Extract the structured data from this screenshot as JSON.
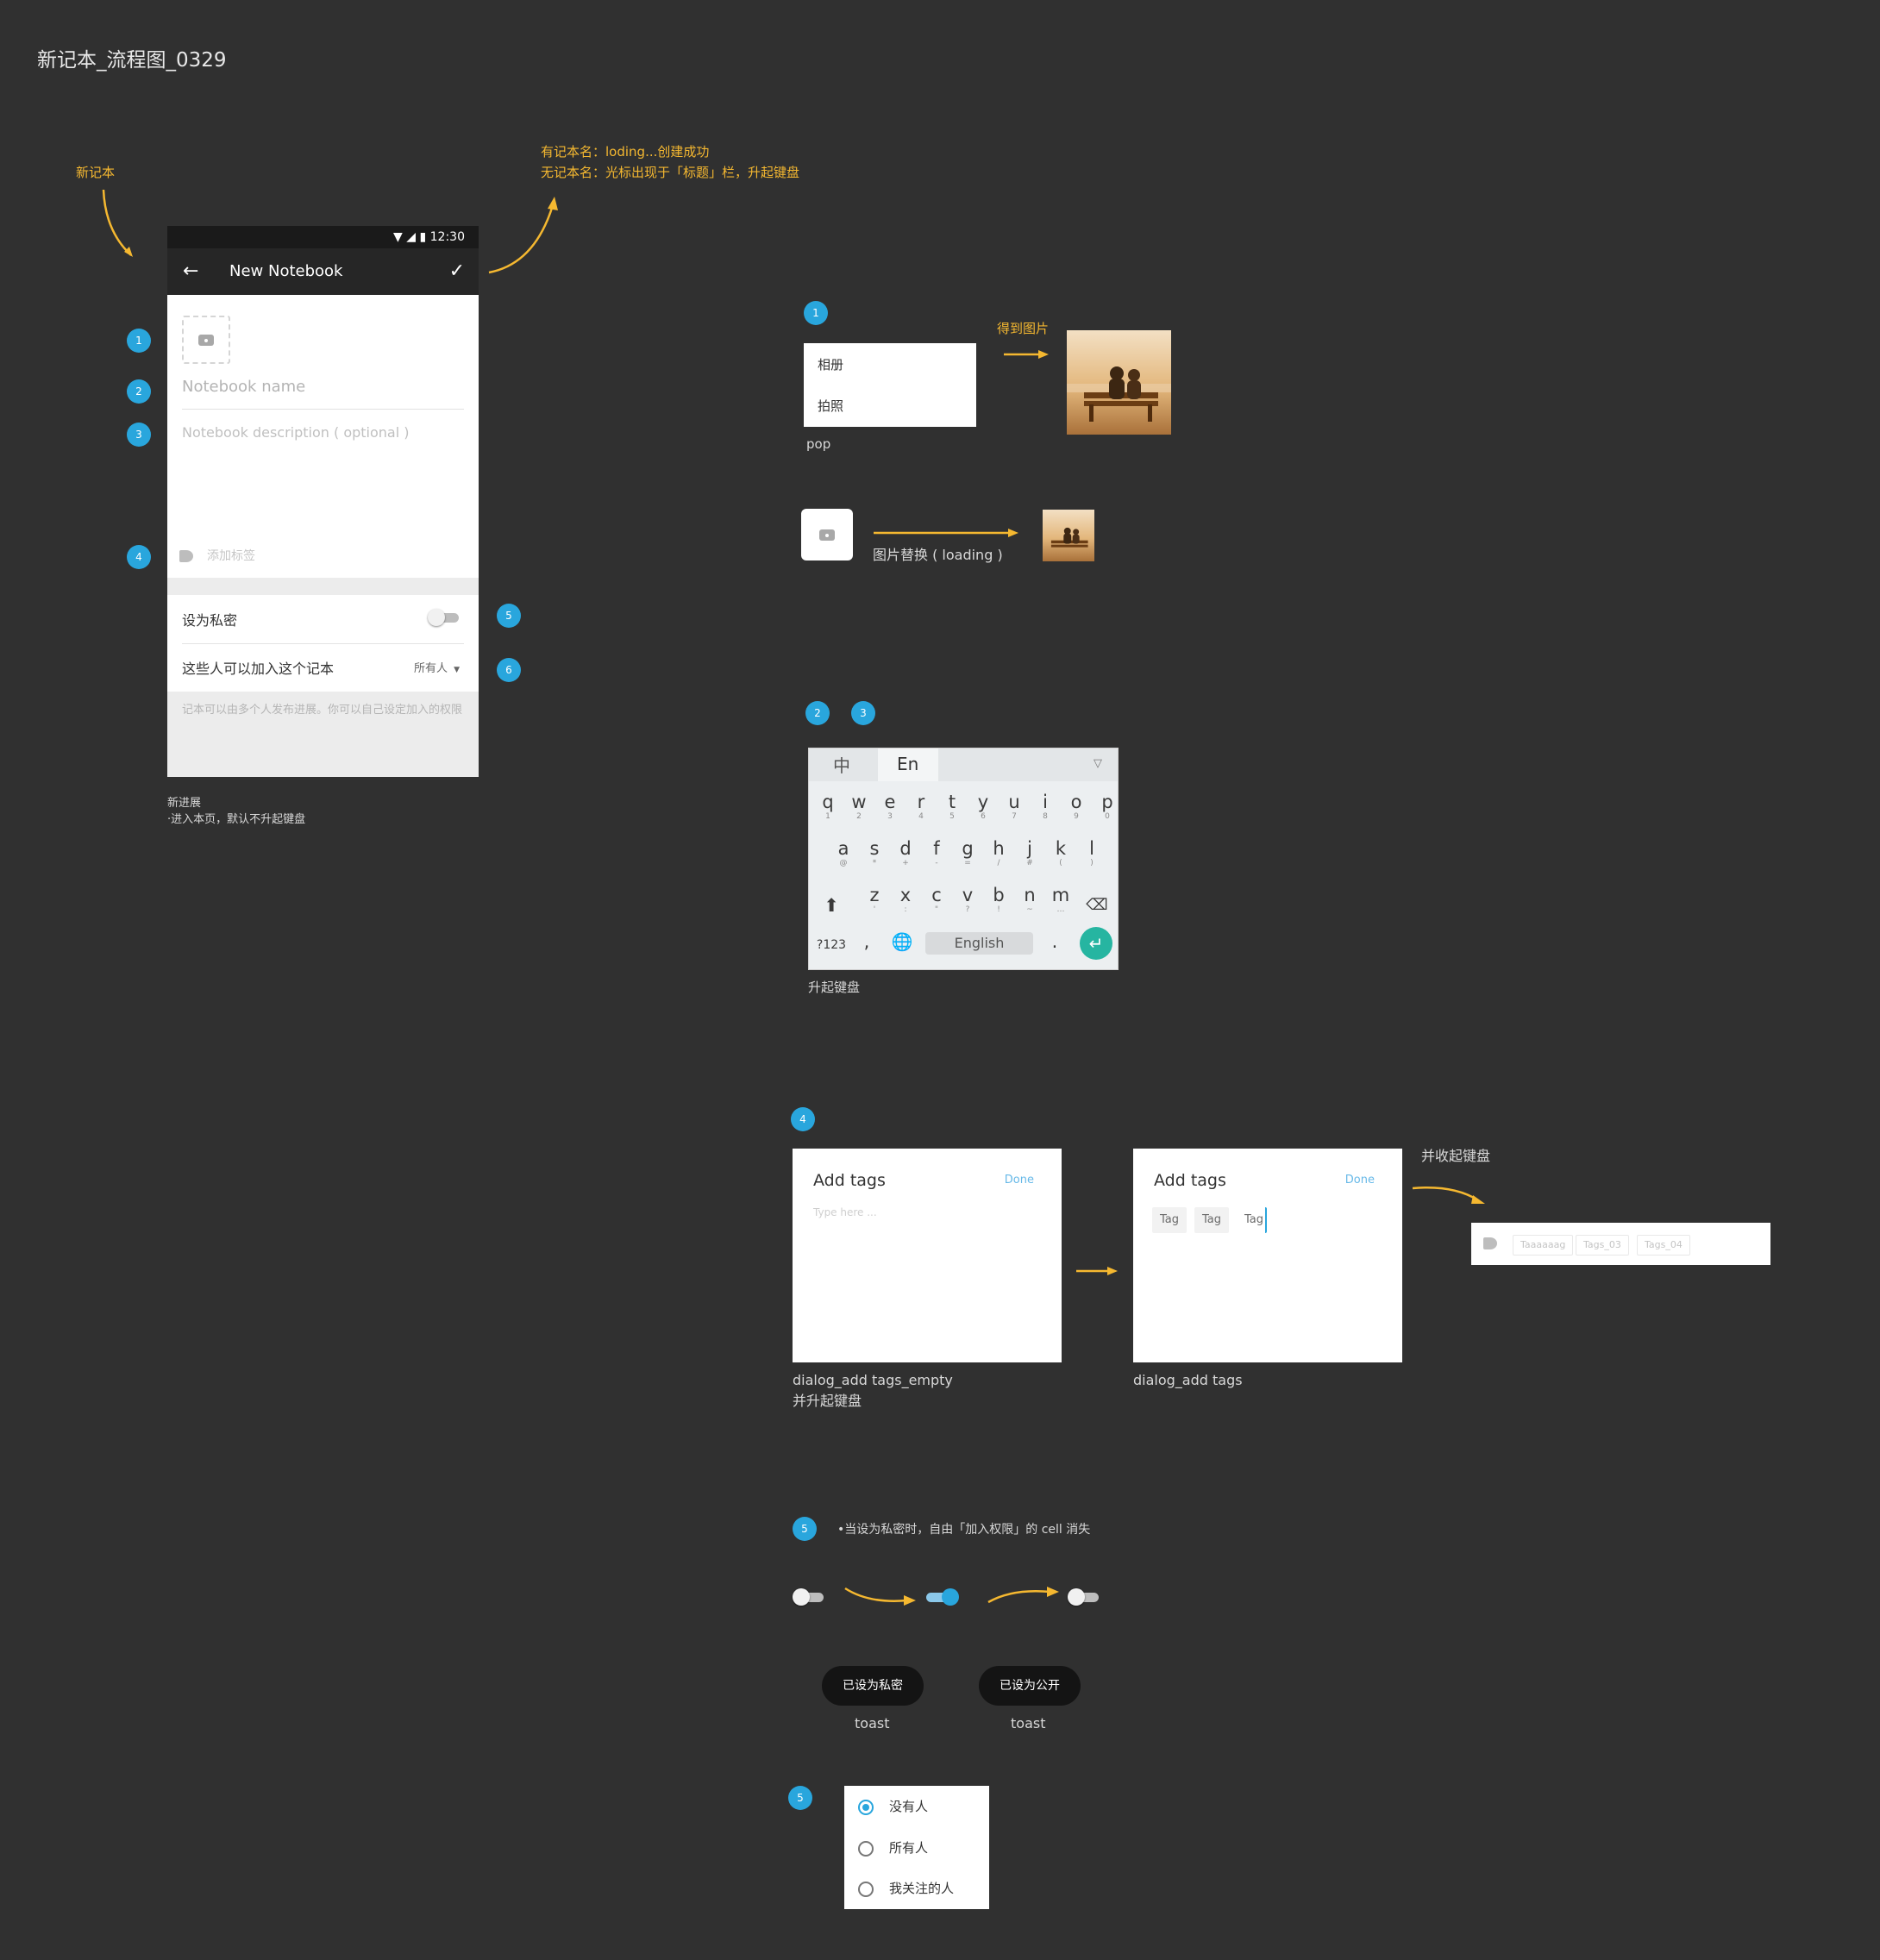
{
  "page_title": "新记本_流程图_0329",
  "flow": {
    "entry_label": "新记本",
    "confirm_note_line1": "有记本名：loding...创建成功",
    "confirm_note_line2": "无记本名：光标出现于「标题」栏，升起键盘"
  },
  "phone": {
    "time": "12:30",
    "appbar_title": "New Notebook",
    "notebook_name_placeholder": "Notebook name",
    "notebook_desc_placeholder": "Notebook description ( optional )",
    "add_tag_label": "添加标签",
    "private_label": "设为私密",
    "private_on": false,
    "join_label": "这些人可以加入这个记本",
    "join_value": "所有人",
    "footer_text": "记本可以由多个人发布进展。你可以自己设定加入的权限",
    "caption_line1": "新进展",
    "caption_line2": "·进入本页，默认不升起键盘"
  },
  "markers": [
    "1",
    "2",
    "3",
    "4",
    "5",
    "6"
  ],
  "section1": {
    "menu_items": [
      "相册",
      "拍照"
    ],
    "menu_caption": "pop",
    "got_image_label": "得到图片",
    "replace_label": "图片替换 ( loading )"
  },
  "section23": {
    "lang_zh": "中",
    "lang_en": "En",
    "row1": [
      [
        "q",
        "1"
      ],
      [
        "w",
        "2"
      ],
      [
        "e",
        "3"
      ],
      [
        "r",
        "4"
      ],
      [
        "t",
        "5"
      ],
      [
        "y",
        "6"
      ],
      [
        "u",
        "7"
      ],
      [
        "i",
        "8"
      ],
      [
        "o",
        "9"
      ],
      [
        "p",
        "0"
      ]
    ],
    "row2": [
      [
        "a",
        "@"
      ],
      [
        "s",
        "*"
      ],
      [
        "d",
        "+"
      ],
      [
        "f",
        "-"
      ],
      [
        "g",
        "="
      ],
      [
        "h",
        "/"
      ],
      [
        "j",
        "#"
      ],
      [
        "k",
        "("
      ],
      [
        "l",
        ")"
      ]
    ],
    "row3": [
      [
        "z",
        "'"
      ],
      [
        "x",
        ":"
      ],
      [
        "c",
        "\""
      ],
      [
        "v",
        "?"
      ],
      [
        "b",
        "!"
      ],
      [
        "n",
        "~"
      ],
      [
        "m",
        "…"
      ]
    ],
    "key_123": "?123",
    "key_comma": ",",
    "space_label": "English",
    "key_period": ".",
    "caption": "升起键盘"
  },
  "section4": {
    "dialog_title": "Add tags",
    "done_label": "Done",
    "input_placeholder": "Type here ...",
    "tags": [
      "Tag",
      "Tag",
      "Tag"
    ],
    "empty_caption_line1": "dialog_add tags_empty",
    "empty_caption_line2": "并升起键盘",
    "filled_caption": "dialog_add tags",
    "collapse_label": "并收起键盘",
    "result_tags": [
      "Taaaaaag",
      "Tags_03",
      "Tags_04"
    ]
  },
  "section5": {
    "note": "•当设为私密时，自由「加入权限」的 cell 消失",
    "toast_private": "已设为私密",
    "toast_public": "已设为公开",
    "toast_caption": "toast",
    "radio_options": [
      "没有人",
      "所有人",
      "我关注的人"
    ],
    "radio_selected": "没有人"
  },
  "colors": {
    "background": "#303030",
    "accent_blue": "#29a6dd",
    "annotation_yellow": "#f5b830",
    "keyboard_enter": "#26b5a1"
  }
}
